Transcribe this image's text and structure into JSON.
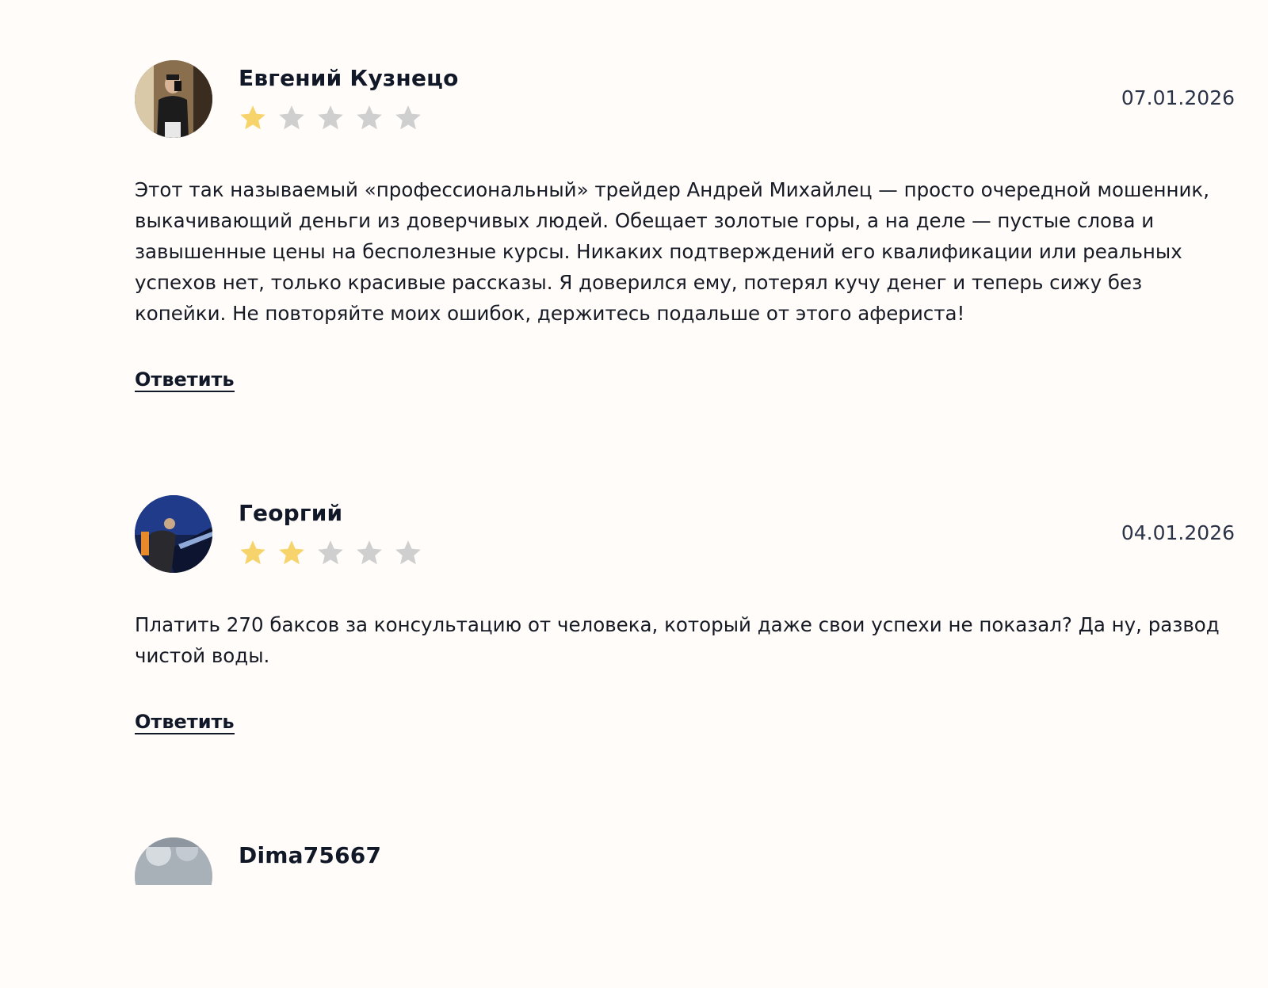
{
  "colors": {
    "star_filled": "#f7d46b",
    "star_empty": "#cfcfcf",
    "background": "#fffcfa"
  },
  "reviews": [
    {
      "author": "Евгений Кузнецо",
      "rating": 1,
      "max_rating": 5,
      "date": "07.01.2026",
      "text": "Этот так называемый «профессиональный» трейдер Андрей Михайлец — просто очередной мошенник, выкачивающий деньги из доверчивых людей. Обещает золотые горы, а на деле — пустые слова и завышенные цены на бесполезные курсы. Никаких подтверждений его квалификации или реальных успехов нет, только красивые рассказы. Я доверился ему, потерял кучу денег и теперь сижу без копейки. Не повторяйте моих ошибок, держитесь подальше от этого афериста!",
      "reply_label": "Ответить"
    },
    {
      "author": "Георгий",
      "rating": 2,
      "max_rating": 5,
      "date": "04.01.2026",
      "text": "Платить 270 баксов за консультацию от человека, который даже свои успехи не показал? Да ну, развод чистой воды.",
      "reply_label": "Ответить"
    },
    {
      "author": "Dima75667"
    }
  ]
}
